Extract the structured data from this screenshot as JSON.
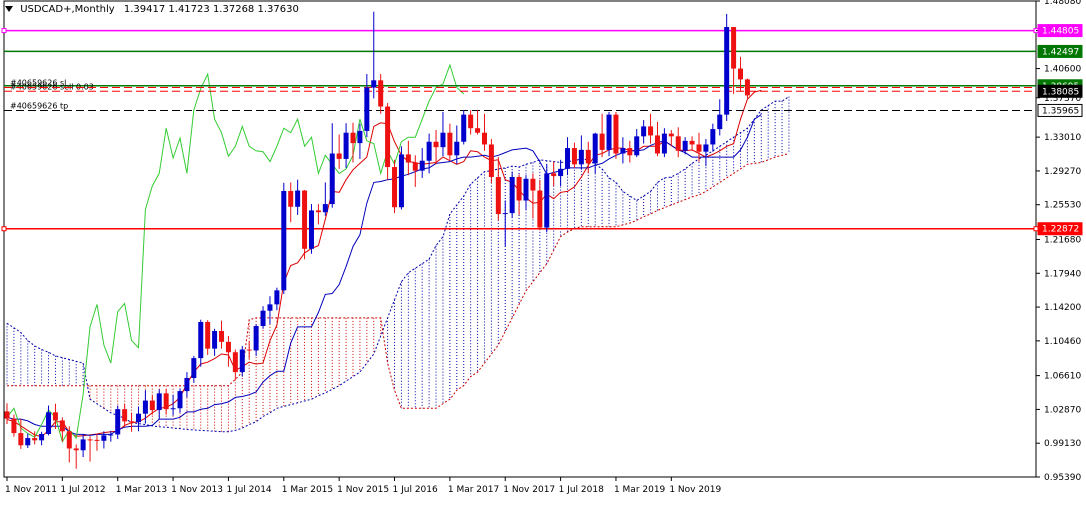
{
  "header": {
    "symbol_label": "USDCAD+,Monthly",
    "ohlc_label": "1.39417 1.41723 1.37268 1.37630"
  },
  "colors": {
    "bull": "#0000cc",
    "bear": "#ee1111",
    "tenkan": "#dd0000",
    "kijun": "#0000bb",
    "chikou": "#33cc33",
    "kumo_bull": "#0000aa",
    "kumo_bear": "#cc0000",
    "line_magenta": "#ff00ff",
    "line_green": "#007700",
    "line_red": "#ff0000"
  },
  "chart_data": {
    "type": "candlestick",
    "title": "USDCAD+,Monthly",
    "ylim": [
      0.9539,
      1.4808
    ],
    "y_ticks": [
      "1.48080",
      "1.44805",
      "1.40600",
      "1.37370",
      "1.33010",
      "1.29270",
      "1.25530",
      "1.21680",
      "1.17940",
      "1.14200",
      "1.10460",
      "1.06610",
      "1.02870",
      "0.99130",
      "0.95390"
    ],
    "x_ticks": [
      "1 Nov 2011",
      "1 Jul 2012",
      "1 Mar 2013",
      "1 Nov 2013",
      "1 Jul 2014",
      "1 Mar 2015",
      "1 Nov 2015",
      "1 Jul 2016",
      "1 Mar 2017",
      "1 Nov 2017",
      "1 Jul 2018",
      "1 Mar 2019",
      "1 Nov 2019"
    ],
    "candles": [
      [
        1.0265,
        1.0355,
        1.0125,
        1.0185
      ],
      [
        1.0185,
        1.023,
        0.9985,
        1.0025
      ],
      [
        1.0025,
        1.018,
        0.985,
        0.989
      ],
      [
        0.989,
        1.002,
        0.986,
        0.997
      ],
      [
        0.997,
        1.0045,
        0.99,
        0.9945
      ],
      [
        0.9945,
        1.004,
        0.989,
        1.0015
      ],
      [
        1.0015,
        1.033,
        1.0,
        1.0255
      ],
      [
        1.0255,
        1.035,
        1.007,
        1.0165
      ],
      [
        1.0165,
        1.02,
        0.993,
        1.0045
      ],
      [
        1.0045,
        1.01,
        0.97,
        0.9855
      ],
      [
        0.9855,
        0.99,
        0.963,
        0.9835
      ],
      [
        0.9835,
        1.0015,
        0.976,
        0.9955
      ],
      [
        0.9955,
        0.999,
        0.971,
        0.995
      ],
      [
        0.995,
        1.002,
        0.983,
        0.994
      ],
      [
        0.994,
        1.0045,
        0.9855,
        1.0
      ],
      [
        1.0,
        1.005,
        0.993,
        1.001
      ],
      [
        1.001,
        1.033,
        0.996,
        1.029
      ],
      [
        1.029,
        1.035,
        1.009,
        1.0155
      ],
      [
        1.0155,
        1.025,
        1.004,
        1.0145
      ],
      [
        1.0145,
        1.032,
        1.0045,
        1.024
      ],
      [
        1.024,
        1.05,
        1.013,
        1.0385
      ],
      [
        1.0385,
        1.044,
        1.023,
        1.028
      ],
      [
        1.028,
        1.051,
        1.018,
        1.0465
      ],
      [
        1.0465,
        1.051,
        1.023,
        1.029
      ],
      [
        1.029,
        1.045,
        1.022,
        1.03
      ],
      [
        1.03,
        1.052,
        1.025,
        1.049
      ],
      [
        1.049,
        1.07,
        1.042,
        1.0635
      ],
      [
        1.0635,
        1.088,
        1.058,
        1.0855
      ],
      [
        1.0855,
        1.128,
        1.076,
        1.1255
      ],
      [
        1.1255,
        1.1275,
        1.089,
        1.096
      ],
      [
        1.096,
        1.118,
        1.088,
        1.1155
      ],
      [
        1.1155,
        1.127,
        1.096,
        1.1035
      ],
      [
        1.1035,
        1.11,
        1.076,
        1.092
      ],
      [
        1.092,
        1.095,
        1.062,
        1.07
      ],
      [
        1.07,
        1.099,
        1.065,
        1.095
      ],
      [
        1.095,
        1.104,
        1.085,
        1.094
      ],
      [
        1.094,
        1.123,
        1.088,
        1.121
      ],
      [
        1.121,
        1.143,
        1.118,
        1.138
      ],
      [
        1.138,
        1.154,
        1.123,
        1.145
      ],
      [
        1.145,
        1.1635,
        1.1385,
        1.1605
      ],
      [
        1.1605,
        1.2795,
        1.1565,
        1.2705
      ],
      [
        1.2705,
        1.28,
        1.236,
        1.253
      ],
      [
        1.253,
        1.283,
        1.244,
        1.271
      ],
      [
        1.271,
        1.2715,
        1.195,
        1.2065
      ],
      [
        1.2065,
        1.256,
        1.201,
        1.249
      ],
      [
        1.249,
        1.256,
        1.2335,
        1.247
      ],
      [
        1.247,
        1.28,
        1.243,
        1.256
      ],
      [
        1.256,
        1.3455,
        1.252,
        1.312
      ],
      [
        1.312,
        1.333,
        1.295,
        1.306
      ],
      [
        1.306,
        1.3455,
        1.296,
        1.335
      ],
      [
        1.335,
        1.346,
        1.302,
        1.3235
      ],
      [
        1.3235,
        1.345,
        1.306,
        1.337
      ],
      [
        1.337,
        1.4,
        1.33,
        1.385
      ],
      [
        1.385,
        1.469,
        1.373,
        1.393
      ],
      [
        1.393,
        1.4,
        1.356,
        1.364
      ],
      [
        1.364,
        1.368,
        1.283,
        1.297
      ],
      [
        1.297,
        1.305,
        1.246,
        1.2525
      ],
      [
        1.2525,
        1.32,
        1.25,
        1.311
      ],
      [
        1.311,
        1.326,
        1.288,
        1.302
      ],
      [
        1.302,
        1.31,
        1.275,
        1.293
      ],
      [
        1.293,
        1.318,
        1.285,
        1.304
      ],
      [
        1.304,
        1.334,
        1.29,
        1.325
      ],
      [
        1.325,
        1.338,
        1.3,
        1.319
      ],
      [
        1.319,
        1.358,
        1.309,
        1.335
      ],
      [
        1.335,
        1.345,
        1.305,
        1.31
      ],
      [
        1.31,
        1.343,
        1.3,
        1.325
      ],
      [
        1.325,
        1.36,
        1.322,
        1.355
      ],
      [
        1.355,
        1.36,
        1.333,
        1.34
      ],
      [
        1.34,
        1.36,
        1.333,
        1.335
      ],
      [
        1.335,
        1.356,
        1.315,
        1.322
      ],
      [
        1.322,
        1.328,
        1.279,
        1.286
      ],
      [
        1.286,
        1.308,
        1.238,
        1.245
      ],
      [
        1.245,
        1.26,
        1.209,
        1.246
      ],
      [
        1.246,
        1.292,
        1.241,
        1.286
      ],
      [
        1.286,
        1.289,
        1.244,
        1.26
      ],
      [
        1.26,
        1.288,
        1.25,
        1.284
      ],
      [
        1.284,
        1.29,
        1.24,
        1.271
      ],
      [
        1.271,
        1.283,
        1.227,
        1.23
      ],
      [
        1.23,
        1.3,
        1.225,
        1.29
      ],
      [
        1.29,
        1.303,
        1.276,
        1.287
      ],
      [
        1.287,
        1.305,
        1.276,
        1.295
      ],
      [
        1.295,
        1.33,
        1.288,
        1.318
      ],
      [
        1.318,
        1.324,
        1.296,
        1.3
      ],
      [
        1.3,
        1.332,
        1.294,
        1.316
      ],
      [
        1.316,
        1.325,
        1.29,
        1.301
      ],
      [
        1.301,
        1.335,
        1.29,
        1.334
      ],
      [
        1.334,
        1.356,
        1.308,
        1.316
      ],
      [
        1.316,
        1.358,
        1.309,
        1.355
      ],
      [
        1.355,
        1.358,
        1.306,
        1.312
      ],
      [
        1.312,
        1.33,
        1.301,
        1.318
      ],
      [
        1.318,
        1.326,
        1.302,
        1.31
      ],
      [
        1.31,
        1.339,
        1.308,
        1.331
      ],
      [
        1.331,
        1.349,
        1.323,
        1.342
      ],
      [
        1.342,
        1.356,
        1.323,
        1.332
      ],
      [
        1.332,
        1.347,
        1.309,
        1.312
      ],
      [
        1.312,
        1.34,
        1.308,
        1.334
      ],
      [
        1.334,
        1.338,
        1.32,
        1.331
      ],
      [
        1.331,
        1.341,
        1.308,
        1.315
      ],
      [
        1.315,
        1.33,
        1.311,
        1.326
      ],
      [
        1.326,
        1.331,
        1.315,
        1.322
      ],
      [
        1.322,
        1.335,
        1.303,
        1.314
      ],
      [
        1.314,
        1.328,
        1.298,
        1.322
      ],
      [
        1.322,
        1.345,
        1.315,
        1.339
      ],
      [
        1.339,
        1.372,
        1.332,
        1.355
      ],
      [
        1.355,
        1.4665,
        1.348,
        1.452
      ],
      [
        1.452,
        1.426,
        1.378,
        1.406
      ],
      [
        1.406,
        1.419,
        1.381,
        1.394
      ],
      [
        1.394,
        1.395,
        1.373,
        1.3763
      ]
    ],
    "series": [
      {
        "name": "",
        "role": "tenkan",
        "values": [
          1.0175,
          1.0155,
          1.0105,
          1.0055,
          1.0005,
          0.9985,
          1.0055,
          1.015,
          1.015,
          1.0035,
          0.999,
          0.9995,
          1.0005,
          1.0015,
          1.003,
          1.004,
          1.0045,
          1.011,
          1.014,
          1.015,
          1.019,
          1.025,
          1.03,
          1.031,
          1.035,
          1.042,
          1.057,
          1.07,
          1.079,
          1.081,
          1.085,
          1.09,
          1.089,
          1.072,
          1.076,
          1.081,
          1.079,
          1.08,
          1.105,
          1.122,
          1.169,
          1.188,
          1.191,
          1.202,
          1.207,
          1.21,
          1.239,
          1.27,
          1.269,
          1.283,
          1.294,
          1.301,
          1.308,
          1.342,
          1.346,
          1.345,
          1.325,
          1.31,
          1.303,
          1.302,
          1.3,
          1.301,
          1.302,
          1.308,
          1.304,
          1.3,
          1.303,
          1.315,
          1.314,
          1.308,
          1.304,
          1.305,
          1.283,
          1.28,
          1.271,
          1.263,
          1.257,
          1.258,
          1.267,
          1.262,
          1.269,
          1.27,
          1.275,
          1.286,
          1.299,
          1.31,
          1.312,
          1.316,
          1.318,
          1.318,
          1.315,
          1.315,
          1.32,
          1.32,
          1.32,
          1.326,
          1.321,
          1.316,
          1.315,
          1.316,
          1.312,
          1.308,
          1.311,
          1.315,
          1.32,
          1.323,
          1.35,
          1.372,
          1.38,
          1.382
        ]
      },
      {
        "name": "",
        "role": "kijun",
        "values": [
          1.02,
          1.018,
          1.018,
          1.016,
          1.012,
          1.01,
          1.01,
          1.01,
          1.01,
          1.004,
          1.001,
          1.001,
          1.0,
          1.001,
          1.001,
          1.001,
          1.006,
          1.009,
          1.01,
          1.01,
          1.01,
          1.011,
          1.018,
          1.018,
          1.018,
          1.02,
          1.026,
          1.026,
          1.029,
          1.03,
          1.034,
          1.035,
          1.037,
          1.042,
          1.043,
          1.045,
          1.048,
          1.059,
          1.066,
          1.071,
          1.071,
          1.102,
          1.12,
          1.12,
          1.12,
          1.136,
          1.156,
          1.157,
          1.167,
          1.187,
          1.209,
          1.222,
          1.257,
          1.28,
          1.281,
          1.283,
          1.284,
          1.287,
          1.289,
          1.292,
          1.295,
          1.296,
          1.301,
          1.302,
          1.303,
          1.306,
          1.308,
          1.308,
          1.309,
          1.31,
          1.308,
          1.31,
          1.313,
          1.316,
          1.317,
          1.318,
          1.315,
          1.303,
          1.289,
          1.291,
          1.293,
          1.296,
          1.296,
          1.296,
          1.296,
          1.299,
          1.301,
          1.306,
          1.31,
          1.313,
          1.315,
          1.315,
          1.316,
          1.321,
          1.324,
          1.326,
          1.321,
          1.316,
          1.313,
          1.308,
          1.308,
          1.308,
          1.308,
          1.308,
          1.308,
          1.308,
          1.316,
          1.33,
          1.35,
          1.355
        ]
      },
      {
        "name": "",
        "role": "chikou",
        "values": [
          1.02,
          1.03,
          1.008,
          1.002,
          0.998,
          1.012,
          1.028,
          1.02,
          0.993,
          1.006,
          0.997,
          1.045,
          1.12,
          1.145,
          1.1,
          1.08,
          1.137,
          1.146,
          1.105,
          1.097,
          1.25,
          1.276,
          1.29,
          1.34,
          1.307,
          1.329,
          1.29,
          1.36,
          1.384,
          1.4,
          1.35,
          1.335,
          1.309,
          1.32,
          1.342,
          1.32,
          1.315,
          1.314,
          1.303,
          1.32,
          1.34,
          1.335,
          1.35,
          1.32,
          1.33,
          1.29,
          1.31,
          1.3,
          1.29,
          1.295,
          1.31,
          1.35,
          1.326,
          1.323,
          1.29,
          1.315,
          1.3,
          1.325,
          1.33,
          1.33,
          1.35,
          1.37,
          1.385,
          1.389,
          1.41,
          1.385,
          1.378
        ]
      }
    ],
    "kumo": {
      "start_index": 0,
      "span_a": [
        1.124,
        1.119,
        1.114,
        1.105,
        1.099,
        1.095,
        1.092,
        1.088,
        1.086,
        1.084,
        1.082,
        1.08,
        1.04,
        1.035,
        1.03,
        1.025,
        1.022,
        1.019,
        1.014,
        1.013,
        1.012,
        1.0105,
        1.0095,
        1.009,
        1.008,
        1.0075,
        1.0065,
        1.006,
        1.0055,
        1.005,
        1.0045,
        1.004,
        1.004,
        1.0055,
        1.008,
        1.012,
        1.015,
        1.021,
        1.025,
        1.03,
        1.032,
        1.034,
        1.036,
        1.038,
        1.04,
        1.044,
        1.047,
        1.051,
        1.055,
        1.06,
        1.065,
        1.07,
        1.08,
        1.09,
        1.11,
        1.13,
        1.15,
        1.17,
        1.18,
        1.185,
        1.19,
        1.195,
        1.21,
        1.22,
        1.245,
        1.255,
        1.265,
        1.278,
        1.285,
        1.292,
        1.293,
        1.295,
        1.296,
        1.298,
        1.297,
        1.3,
        1.302,
        1.305,
        1.304,
        1.303,
        1.302,
        1.303,
        1.304,
        1.306,
        1.305,
        1.3,
        1.295,
        1.285,
        1.28,
        1.27,
        1.265,
        1.26,
        1.265,
        1.27,
        1.28,
        1.285,
        1.286,
        1.29,
        1.295,
        1.301,
        1.306,
        1.31,
        1.315,
        1.32,
        1.325,
        1.33,
        1.335,
        1.34,
        1.35,
        1.36,
        1.365,
        1.37,
        1.37,
        1.375
      ],
      "span_b": [
        1.055,
        1.055,
        1.055,
        1.055,
        1.055,
        1.055,
        1.055,
        1.055,
        1.055,
        1.055,
        1.055,
        1.055,
        1.055,
        1.055,
        1.055,
        1.055,
        1.055,
        1.055,
        1.055,
        1.055,
        1.055,
        1.055,
        1.055,
        1.055,
        1.055,
        1.055,
        1.055,
        1.055,
        1.055,
        1.055,
        1.055,
        1.055,
        1.055,
        1.062,
        1.07,
        1.128,
        1.13,
        1.13,
        1.13,
        1.13,
        1.13,
        1.13,
        1.13,
        1.13,
        1.13,
        1.13,
        1.13,
        1.13,
        1.13,
        1.13,
        1.13,
        1.13,
        1.13,
        1.13,
        1.13,
        1.08,
        1.05,
        1.03,
        1.03,
        1.03,
        1.03,
        1.03,
        1.03,
        1.035,
        1.04,
        1.05,
        1.055,
        1.065,
        1.07,
        1.08,
        1.09,
        1.1,
        1.115,
        1.13,
        1.145,
        1.16,
        1.17,
        1.18,
        1.19,
        1.205,
        1.22,
        1.225,
        1.229,
        1.231,
        1.231,
        1.231,
        1.231,
        1.231,
        1.231,
        1.233,
        1.235,
        1.238,
        1.242,
        1.245,
        1.249,
        1.252,
        1.255,
        1.258,
        1.261,
        1.264,
        1.266,
        1.27,
        1.275,
        1.28,
        1.285,
        1.29,
        1.295,
        1.3,
        1.301,
        1.302,
        1.305,
        1.308,
        1.31,
        1.312
      ]
    },
    "hlines": [
      {
        "value": 1.44805,
        "label": "1.44805",
        "style": "solid",
        "role": "magenta"
      },
      {
        "value": 1.42497,
        "label": "1.42497",
        "style": "solid",
        "role": "green"
      },
      {
        "value": 1.38695,
        "label": "1.38695",
        "style": "solid",
        "role": "green"
      },
      {
        "value": 1.38085,
        "label": "1.38085",
        "style": "dashed",
        "role": "red-dash",
        "text": "#40659626 sell 0.03"
      },
      {
        "value": 1.385,
        "label": "",
        "style": "dashed",
        "role": "red-dash-sl",
        "text": "#40659626 sl"
      },
      {
        "value": 1.35965,
        "label": "1.35965",
        "style": "dashed",
        "role": "black-dash",
        "text": "#40659626 tp"
      },
      {
        "value": 1.22872,
        "label": "1.22872",
        "style": "solid",
        "role": "red"
      }
    ],
    "current_price": "1.38085",
    "grid": false,
    "legend": "none"
  }
}
